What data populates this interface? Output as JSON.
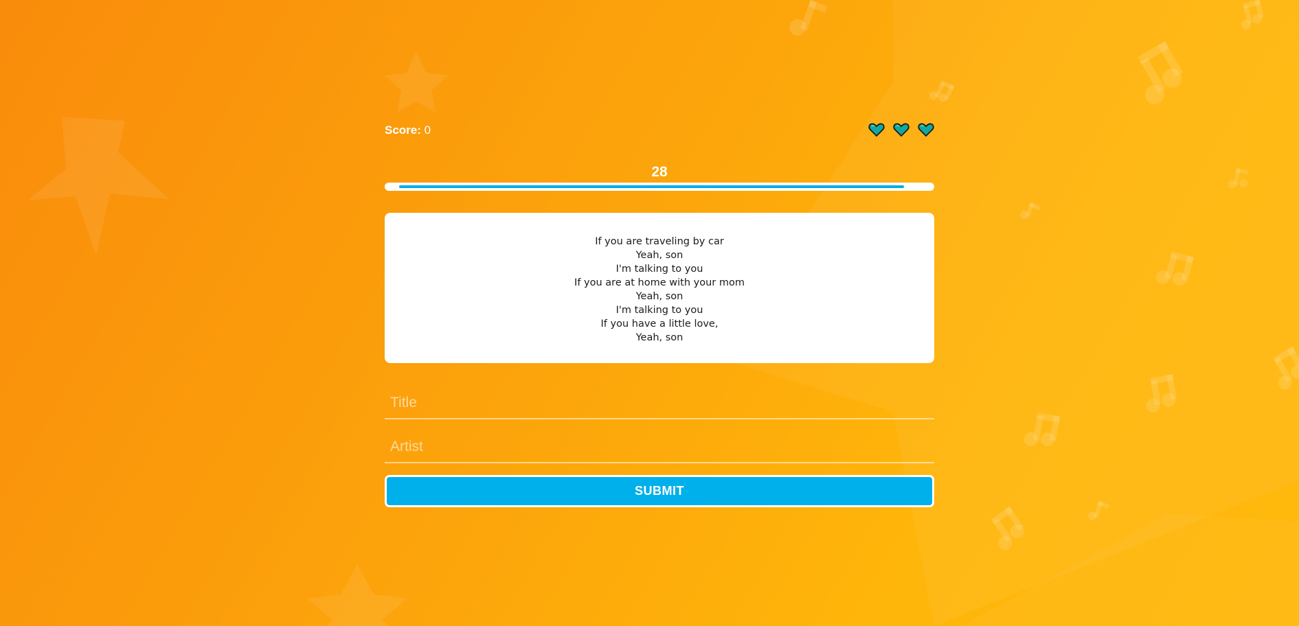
{
  "score": {
    "label": "Score:",
    "value": "0"
  },
  "lives": {
    "count": 3,
    "icon": "heart-icon",
    "color": "#13a89e"
  },
  "timer": {
    "value": "28",
    "progress_fraction": 0.97
  },
  "lyrics": [
    "If you are traveling by car",
    "Yeah, son",
    "I'm talking to you",
    "If you are at home with your mom",
    "Yeah, son",
    "I'm talking to you",
    "If you have a little love,",
    "Yeah, son"
  ],
  "form": {
    "title_placeholder": "Title",
    "artist_placeholder": "Artist",
    "title_value": "",
    "artist_value": "",
    "submit_label": "SUBMIT"
  },
  "colors": {
    "background_start": "#f98c0b",
    "background_end": "#ffb80c",
    "accent": "#00b0ea",
    "card": "#ffffff"
  }
}
